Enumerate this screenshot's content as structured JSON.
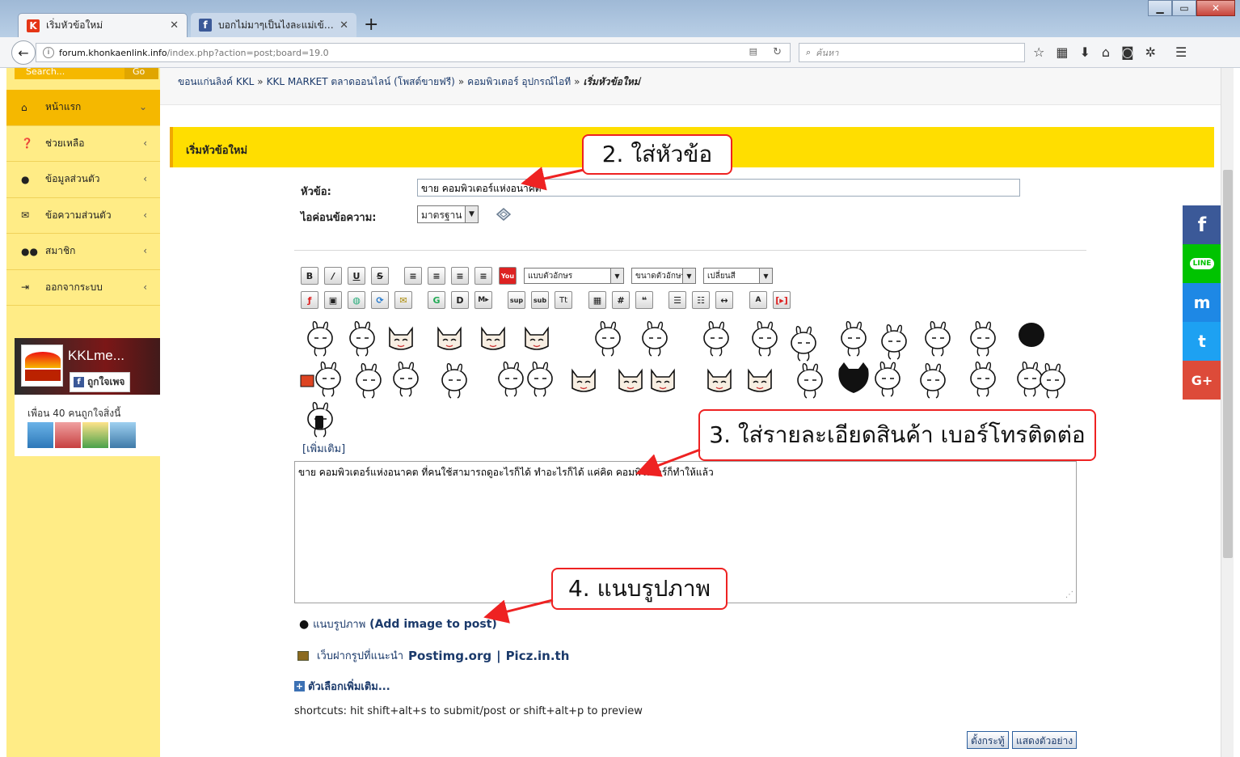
{
  "browser": {
    "tabs": [
      {
        "title": "เริ่มหัวข้อใหม่",
        "active": true
      },
      {
        "title": "บอกไม่มาๆเป็นไงละแม่เข้าห้อง",
        "active": false
      }
    ],
    "url_host": "forum.khonkaenlink.info",
    "url_path": "/index.php?action=post;board=19.0",
    "search_placeholder": "ค้นหา"
  },
  "sidebar": {
    "search_placeholder": "Search...",
    "search_button": "Go",
    "menu": [
      {
        "icon": "home-icon",
        "label": "หน้าแรก",
        "active": true
      },
      {
        "icon": "help-icon",
        "label": "ช่วยเหลือ",
        "active": false
      },
      {
        "icon": "user-icon",
        "label": "ข้อมูลส่วนตัว",
        "active": false
      },
      {
        "icon": "envelope-icon",
        "label": "ข้อความส่วนตัว",
        "active": false
      },
      {
        "icon": "users-icon",
        "label": "สมาชิก",
        "active": false
      },
      {
        "icon": "logout-icon",
        "label": "ออกจากระบบ",
        "active": false
      }
    ],
    "fb": {
      "page_name": "KKLme...",
      "like_label": "ถูกใจเพจ",
      "friends_text": "เพื่อน 40 คนถูกใจสิ่งนี้"
    }
  },
  "breadcrumb": {
    "items": [
      "ขอนแก่นลิงค์ KKL",
      "KKL MARKET ตลาดออนไลน์ (โพสต์ขายฟรี)",
      "คอมพิวเตอร์ อุปกรณ์ไอที"
    ],
    "current": "เริ่มหัวข้อใหม่",
    "separator": "»"
  },
  "form": {
    "header": "เริ่มหัวข้อใหม่",
    "subject_label": "หัวข้อ:",
    "subject_value": "ขาย คอมพิวเตอร์แห่งอนาคต",
    "icon_label": "ไอค่อนข้อความ:",
    "icon_value": "มาตรฐาน",
    "font_face_select": "แบบตัวอักษร",
    "font_size_select": "ขนาดตัวอักษร",
    "color_select": "เปลี่ยนสี",
    "more_smileys": "[เพิ่มเติม]",
    "message_value": "ขาย คอมพิวเตอร์แห่งอนาคต ที่คนใช้สามารถดูอะไรก็ได้ ทำอะไรก็ได้ แค่คิด คอมพิวเตอร์ก็ทำให้แล้ว",
    "attach_thai": "แนบรูปภาพ",
    "attach_en": "(Add image to post)",
    "hosts_label": "เว็บฝากรูปที่แนะนำ",
    "host1": "Postimg.org",
    "host_sep": "|",
    "host2": "Picz.in.th",
    "more_options": "ตัวเลือกเพิ่มเติม...",
    "shortcuts": "shortcuts: hit shift+alt+s to submit/post or shift+alt+p to preview",
    "post_button": "ตั้งกระทู้",
    "preview_button": "แสดงตัวอย่าง"
  },
  "annotations": {
    "step2": "2. ใส่หัวข้อ",
    "step3": "3. ใส่รายละเอียดสินค้า เบอร์โทรติดต่อ",
    "step4": "4. แนบรูปภาพ"
  },
  "share": [
    "f",
    "LINE",
    "m",
    "t",
    "G+"
  ],
  "colors": {
    "sidebar_bg": "#ffec86",
    "accent": "#f5b800",
    "header_bar": "#ffde00",
    "link": "#1b3a6b",
    "callout_border": "#e22222"
  }
}
